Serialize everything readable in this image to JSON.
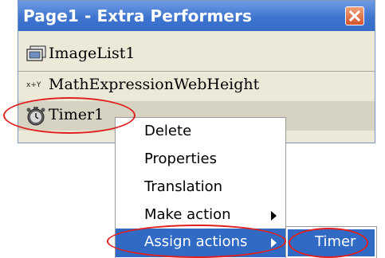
{
  "panel": {
    "title": "Page1 - Extra Performers",
    "items": [
      {
        "label": "ImageList1",
        "icon": "imagelist-icon"
      },
      {
        "label": "MathExpressionWebHeight",
        "icon": "math-expression-icon"
      },
      {
        "label": "Timer1",
        "icon": "timer-icon"
      }
    ]
  },
  "context_menu": {
    "items": [
      {
        "label": "Delete"
      },
      {
        "label": "Properties"
      },
      {
        "label": "Translation"
      },
      {
        "label": "Make action",
        "has_submenu": true
      },
      {
        "label": "Assign actions",
        "has_submenu": true,
        "highlighted": true
      }
    ]
  },
  "submenu": {
    "items": [
      {
        "label": "Timer",
        "highlighted": true
      }
    ]
  },
  "colors": {
    "titlebar": "#3f75cf",
    "panel_bg": "#ece9d8",
    "menu_highlight": "#316ac5",
    "annotation": "#e02020"
  }
}
